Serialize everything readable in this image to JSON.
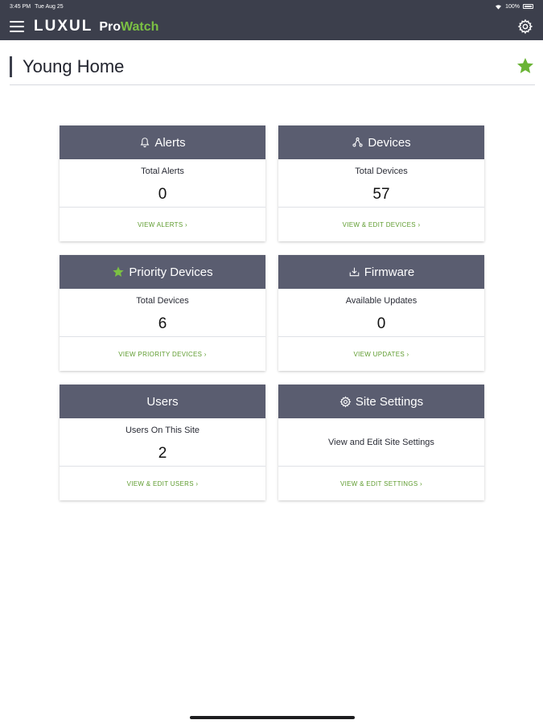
{
  "status_bar": {
    "time": "3:45 PM",
    "date": "Tue Aug 25",
    "battery": "100%"
  },
  "navbar": {
    "brand": "LUXUL",
    "product_pro": "Pro",
    "product_watch": "Watch",
    "accent_color": "#7bc043"
  },
  "page": {
    "title": "Young Home",
    "favorite": true
  },
  "cards": [
    {
      "title": "Alerts",
      "icon": "bell-icon",
      "label": "Total Alerts",
      "value": "0",
      "link": "VIEW ALERTS"
    },
    {
      "title": "Devices",
      "icon": "devices-icon",
      "label": "Total Devices",
      "value": "57",
      "link": "VIEW & EDIT DEVICES"
    },
    {
      "title": "Priority Devices",
      "icon": "star-icon",
      "label": "Total Devices",
      "value": "6",
      "link": "VIEW PRIORITY DEVICES"
    },
    {
      "title": "Firmware",
      "icon": "download-icon",
      "label": "Available Updates",
      "value": "0",
      "link": "VIEW UPDATES"
    },
    {
      "title": "Users",
      "icon": "",
      "label": "Users On This Site",
      "value": "2",
      "link": "VIEW & EDIT USERS"
    },
    {
      "title": "Site Settings",
      "icon": "gear-icon",
      "label": "View and Edit Site Settings",
      "value": "",
      "link": "VIEW & EDIT SETTINGS"
    }
  ]
}
